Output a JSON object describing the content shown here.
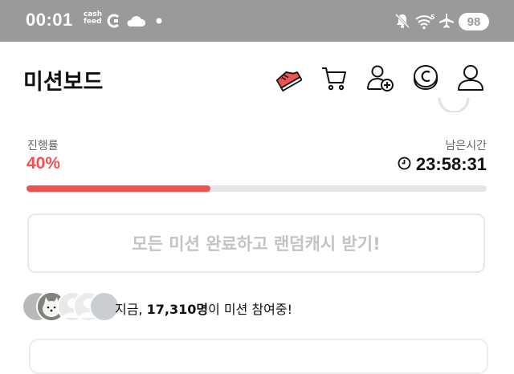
{
  "status_bar": {
    "time": "00:01",
    "cash_logo_line1": "cash",
    "cash_logo_line2": "feed",
    "battery": "98",
    "icons": [
      "cashfeed-logo",
      "c-app-icon",
      "cloud-icon",
      "dot-icon",
      "mute-icon",
      "wifi-icon",
      "airplane-icon",
      "battery-icon"
    ]
  },
  "header": {
    "title": "미션보드",
    "icons": [
      "sneaker-icon",
      "cart-icon",
      "add-friend-icon",
      "coin-icon",
      "profile-icon"
    ],
    "accent": "#ef5350"
  },
  "progress": {
    "label": "진행률",
    "value": "40%",
    "fraction": 0.4
  },
  "timer": {
    "label": "남은시간",
    "value": "23:58:31"
  },
  "reward_button": {
    "label": "모든 미션 완료하고 랜덤캐시 받기!"
  },
  "participants": {
    "prefix": "지금, ",
    "count": "17,310명",
    "suffix": "이 미션 참여중!"
  }
}
